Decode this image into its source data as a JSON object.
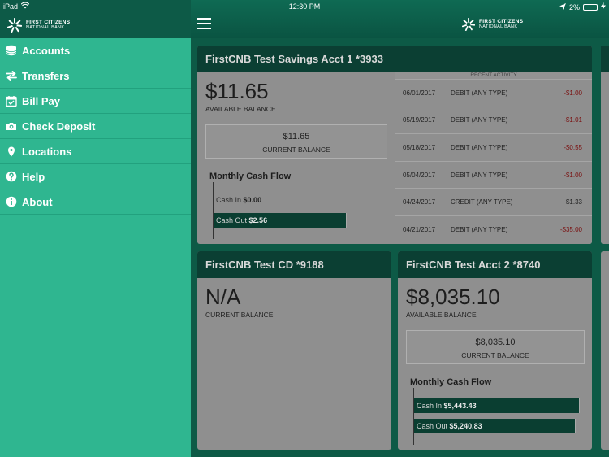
{
  "status_bar": {
    "carrier": "iPad",
    "time": "12:30 PM",
    "battery": "2%"
  },
  "brand": {
    "line1": "FIRST CITIZENS",
    "line2": "NATIONAL BANK"
  },
  "menu": [
    {
      "label": "Accounts",
      "icon": "accounts-icon"
    },
    {
      "label": "Transfers",
      "icon": "transfer-arrows-icon"
    },
    {
      "label": "Bill Pay",
      "icon": "calendar-check-icon"
    },
    {
      "label": "Check Deposit",
      "icon": "camera-icon"
    },
    {
      "label": "Locations",
      "icon": "map-pin-icon"
    },
    {
      "label": "Help",
      "icon": "help-icon"
    },
    {
      "label": "About",
      "icon": "info-icon"
    }
  ],
  "accounts": [
    {
      "title": "FirstCNB Test Savings Acct 1 *3933",
      "balance": "$11.65",
      "balance_label": "AVAILABLE BALANCE",
      "current_value": "$11.65",
      "current_label": "CURRENT BALANCE",
      "cash_flow_title": "Monthly Cash Flow",
      "cash_in_label": "Cash In",
      "cash_in": "$0.00",
      "cash_out_label": "Cash Out",
      "cash_out": "$2.56",
      "recent_activity_title": "RECENT ACTIVITY",
      "activity": [
        {
          "date": "06/01/2017",
          "type": "DEBIT (ANY TYPE)",
          "amount": "-$1.00"
        },
        {
          "date": "05/19/2017",
          "type": "DEBIT (ANY TYPE)",
          "amount": "-$1.01"
        },
        {
          "date": "05/18/2017",
          "type": "DEBIT (ANY TYPE)",
          "amount": "-$0.55"
        },
        {
          "date": "05/04/2017",
          "type": "DEBIT (ANY TYPE)",
          "amount": "-$1.00"
        },
        {
          "date": "04/24/2017",
          "type": "CREDIT (ANY TYPE)",
          "amount": "$1.33"
        },
        {
          "date": "04/21/2017",
          "type": "DEBIT (ANY TYPE)",
          "amount": "-$35.00"
        }
      ]
    },
    {
      "title": "FirstCNB Test CD  *9188",
      "balance": "N/A",
      "balance_label": "CURRENT BALANCE"
    },
    {
      "title": "FirstCNB Test Acct 2 *8740",
      "balance": "$8,035.10",
      "balance_label": "AVAILABLE BALANCE",
      "current_value": "$8,035.10",
      "current_label": "CURRENT BALANCE",
      "cash_flow_title": "Monthly Cash Flow",
      "cash_in_label": "Cash In",
      "cash_in": "$5,443.43",
      "cash_out_label": "Cash Out",
      "cash_out": "$5,240.83"
    }
  ],
  "colors": {
    "sidebar": "#2fb690",
    "header": "#0b3f33",
    "card": "#8f8f8f",
    "debit": "#7a1010"
  }
}
